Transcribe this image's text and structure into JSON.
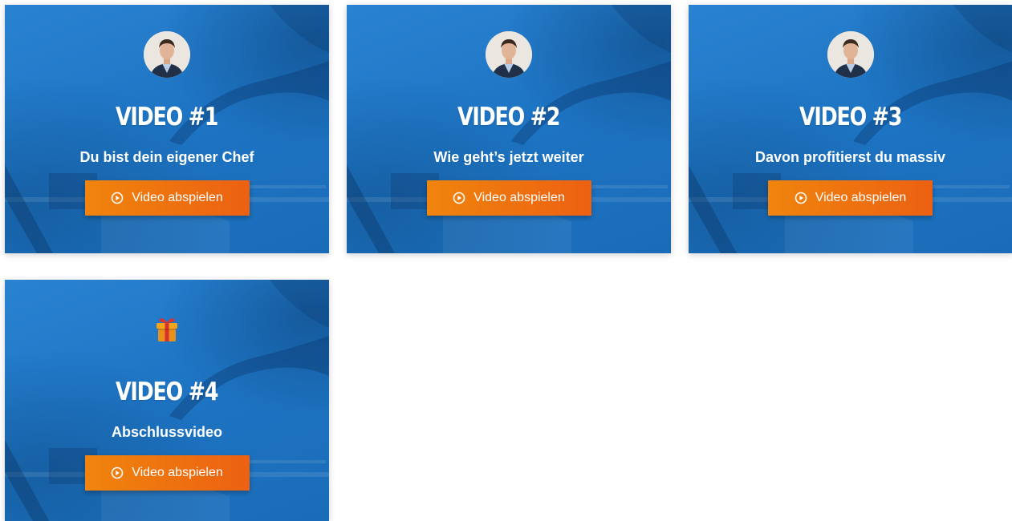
{
  "cards": [
    {
      "title": "VIDEO #1",
      "subtitle": "Du bist dein eigener Chef",
      "button_label": "Video abspielen",
      "icon": "avatar-icon"
    },
    {
      "title": "VIDEO #2",
      "subtitle": "Wie geht’s jetzt weiter",
      "button_label": "Video abspielen",
      "icon": "avatar-icon"
    },
    {
      "title": "VIDEO #3",
      "subtitle": "Davon profitierst du massiv",
      "button_label": "Video abspielen",
      "icon": "avatar-icon"
    },
    {
      "title": "VIDEO #4",
      "subtitle": "Abschlussvideo",
      "button_label": "Video abspielen",
      "icon": "gift-icon"
    }
  ],
  "colors": {
    "card_blue": "#1f78c8",
    "button_orange_start": "#f0840d",
    "button_orange_end": "#ec6112"
  }
}
